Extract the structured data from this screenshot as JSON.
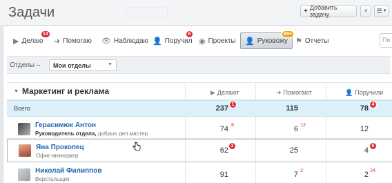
{
  "header": {
    "title": "Задачи",
    "add_task_label": "Добавить задачу",
    "add_task_icon": "+",
    "flash_icon": "⚡",
    "menu_icon": "☰"
  },
  "tabs": [
    {
      "label": "Делаю",
      "icon": "▶",
      "badge": "14"
    },
    {
      "label": "Помогаю",
      "icon": "➜"
    },
    {
      "label": "Наблюдаю",
      "icon": "👁"
    },
    {
      "label": "Поручил",
      "icon": "👤",
      "badge": "6"
    },
    {
      "label": "Проекты",
      "icon": "◉"
    },
    {
      "label": "Руковожу",
      "icon": "👤",
      "badge": "99+"
    },
    {
      "label": "Отчеты",
      "icon": "⚑"
    }
  ],
  "search": {
    "placeholder": "По"
  },
  "filter": {
    "label": "Отделы –",
    "value": "Мои отделы"
  },
  "table": {
    "group_title": "Маркетинг и реклама",
    "columns": [
      {
        "label": "Делают",
        "icon": "▶"
      },
      {
        "label": "Помогают",
        "icon": "➜"
      },
      {
        "label": "Поручили",
        "icon": "👤"
      }
    ],
    "total": {
      "label": "Всего",
      "doing": "237",
      "doing_badge": "1",
      "helping": "115",
      "assigned": "78",
      "assigned_badge": "4"
    },
    "rows": [
      {
        "name": "Герасимюк Антон",
        "role": "Руководитель отдела,",
        "note": "добрых дел мастер",
        "doing": "74",
        "doing_sup": "6",
        "helping": "6",
        "helping_sup": "12",
        "assigned": "12"
      },
      {
        "name": "Яна Прокопец",
        "role": "Офис-менеджер",
        "doing": "62",
        "doing_badge": "3",
        "helping": "25",
        "assigned": "4",
        "assigned_badge": "6"
      },
      {
        "name": "Николай Филиппов",
        "role": "Верстальщик",
        "doing": "91",
        "helping": "7",
        "helping_sup": "2",
        "assigned": "2",
        "assigned_sup": "24"
      }
    ]
  }
}
